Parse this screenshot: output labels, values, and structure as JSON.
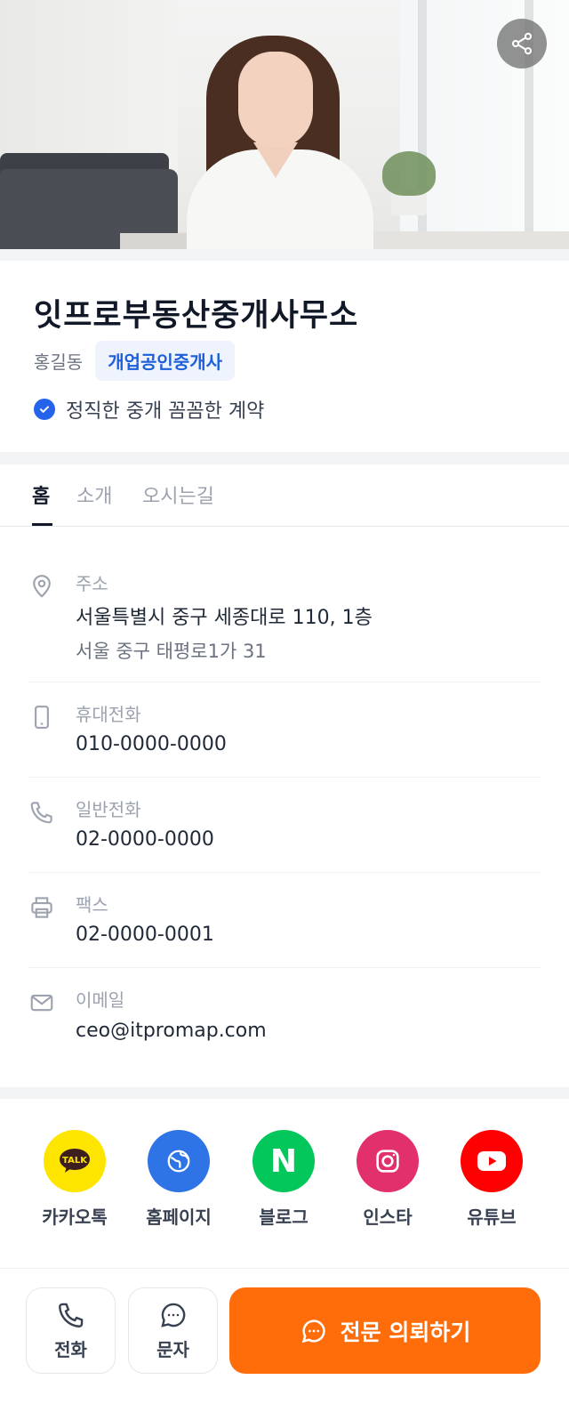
{
  "hero": {
    "image_alt": ""
  },
  "profile": {
    "office_name": "잇프로부동산중개사무소",
    "agent_name": "홍길동",
    "agent_title": "개업공인중개사",
    "motto": "정직한 중개 꼼꼼한 계약"
  },
  "tabs": [
    {
      "label": "홈",
      "active": true
    },
    {
      "label": "소개",
      "active": false
    },
    {
      "label": "오시는길",
      "active": false
    }
  ],
  "contact": {
    "address": {
      "label": "주소",
      "road": "서울특별시 중구 세종대로 110, 1층",
      "lot": "서울 중구 태평로1가 31"
    },
    "mobile": {
      "label": "휴대전화",
      "value": "010-0000-0000"
    },
    "phone": {
      "label": "일반전화",
      "value": "02-0000-0000"
    },
    "fax": {
      "label": "팩스",
      "value": "02-0000-0001"
    },
    "email": {
      "label": "이메일",
      "value": "ceo@itpromap.com"
    }
  },
  "social": [
    {
      "label": "카카오톡",
      "icon": "kakaotalk-icon",
      "color": "#fee500"
    },
    {
      "label": "홈페이지",
      "icon": "globe-icon",
      "color": "#2f74e6"
    },
    {
      "label": "블로그",
      "icon": "naver-blog-icon",
      "color": "#03c75a"
    },
    {
      "label": "인스타",
      "icon": "instagram-icon",
      "color": "#e1306c"
    },
    {
      "label": "유튜브",
      "icon": "youtube-icon",
      "color": "#ff0000"
    }
  ],
  "kakao_badge": "TALK",
  "naver_letter": "N",
  "actions": {
    "call_label": "전화",
    "sms_label": "문자",
    "request_label": "전문 의뢰하기",
    "request_color": "#ff6d0a"
  }
}
